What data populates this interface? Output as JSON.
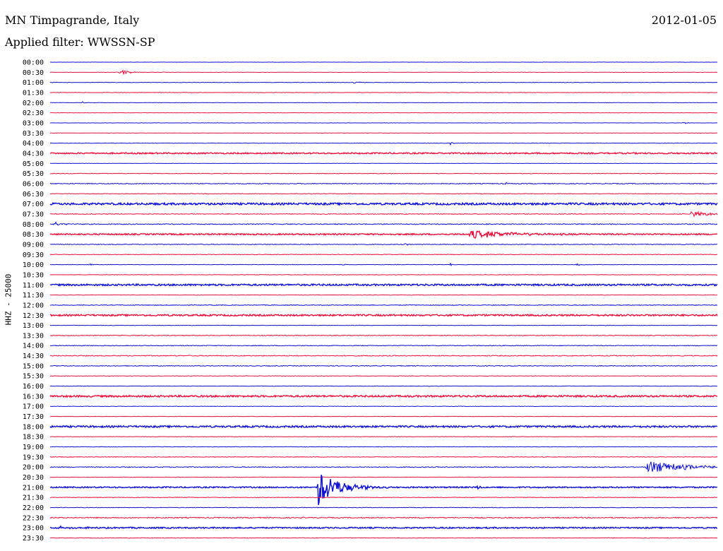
{
  "header": {
    "station": "MN Timpagrande, Italy",
    "filter_label": "Applied filter: WWSSN-SP",
    "date": "2012-01-05"
  },
  "chart_data": {
    "type": "line",
    "title": "MN Timpagrande, Italy",
    "subtitle": "Applied filter: WWSSN-SP",
    "date": "2012-01-05",
    "ylabel": "HHZ - 25000",
    "xlabel": "",
    "grid": false,
    "row_minutes": 30,
    "colors": {
      "even_row": "#1010d0",
      "odd_row": "#e8103c"
    },
    "rows": [
      {
        "label": "00:00",
        "noise": 0.2,
        "events": []
      },
      {
        "label": "00:30",
        "noise": 0.2,
        "events": [
          {
            "t": 0.105,
            "amp": 5,
            "dur": 0.015
          }
        ]
      },
      {
        "label": "01:00",
        "noise": 0.3,
        "events": [
          {
            "t": 0.455,
            "amp": 2,
            "dur": 0.012
          }
        ]
      },
      {
        "label": "01:30",
        "noise": 0.3,
        "events": []
      },
      {
        "label": "02:00",
        "noise": 0.2,
        "events": [
          {
            "t": 0.048,
            "amp": 2,
            "dur": 0.004
          }
        ]
      },
      {
        "label": "02:30",
        "noise": 0.2,
        "events": []
      },
      {
        "label": "03:00",
        "noise": 0.2,
        "events": [
          {
            "t": 0.95,
            "amp": 2,
            "dur": 0.006
          }
        ]
      },
      {
        "label": "03:30",
        "noise": 0.2,
        "events": []
      },
      {
        "label": "04:00",
        "noise": 0.3,
        "events": [
          {
            "t": 0.6,
            "amp": 2,
            "dur": 0.005
          }
        ]
      },
      {
        "label": "04:30",
        "noise": 0.9,
        "events": []
      },
      {
        "label": "05:00",
        "noise": 0.2,
        "events": []
      },
      {
        "label": "05:30",
        "noise": 0.4,
        "events": []
      },
      {
        "label": "06:00",
        "noise": 0.6,
        "events": [
          {
            "t": 0.683,
            "amp": 2,
            "dur": 0.004
          }
        ]
      },
      {
        "label": "06:30",
        "noise": 0.4,
        "events": []
      },
      {
        "label": "07:00",
        "noise": 1.4,
        "events": []
      },
      {
        "label": "07:30",
        "noise": 0.5,
        "events": [
          {
            "t": 0.96,
            "amp": 4,
            "dur": 0.04
          }
        ]
      },
      {
        "label": "08:00",
        "noise": 0.6,
        "events": [
          {
            "t": 0.006,
            "amp": 3,
            "dur": 0.015
          }
        ]
      },
      {
        "label": "08:30",
        "noise": 0.9,
        "events": [
          {
            "t": 0.63,
            "amp": 6,
            "dur": 0.07
          }
        ]
      },
      {
        "label": "09:00",
        "noise": 0.5,
        "events": [
          {
            "t": 0.533,
            "amp": 2,
            "dur": 0.004
          }
        ]
      },
      {
        "label": "09:30",
        "noise": 0.4,
        "events": []
      },
      {
        "label": "10:00",
        "noise": 0.3,
        "events": [
          {
            "t": 0.06,
            "amp": 2,
            "dur": 0.003
          },
          {
            "t": 0.44,
            "amp": 2,
            "dur": 0.003
          },
          {
            "t": 0.6,
            "amp": 2,
            "dur": 0.003
          },
          {
            "t": 0.79,
            "amp": 3,
            "dur": 0.01
          }
        ]
      },
      {
        "label": "10:30",
        "noise": 0.3,
        "events": []
      },
      {
        "label": "11:00",
        "noise": 1.2,
        "events": []
      },
      {
        "label": "11:30",
        "noise": 0.3,
        "events": []
      },
      {
        "label": "12:00",
        "noise": 0.5,
        "events": []
      },
      {
        "label": "12:30",
        "noise": 1.1,
        "events": []
      },
      {
        "label": "13:00",
        "noise": 0.3,
        "events": []
      },
      {
        "label": "13:30",
        "noise": 0.5,
        "events": []
      },
      {
        "label": "14:00",
        "noise": 0.5,
        "events": []
      },
      {
        "label": "14:30",
        "noise": 0.6,
        "events": []
      },
      {
        "label": "15:00",
        "noise": 0.5,
        "events": []
      },
      {
        "label": "15:30",
        "noise": 0.3,
        "events": []
      },
      {
        "label": "16:00",
        "noise": 0.3,
        "events": []
      },
      {
        "label": "16:30",
        "noise": 1.2,
        "events": []
      },
      {
        "label": "17:00",
        "noise": 0.3,
        "events": []
      },
      {
        "label": "17:30",
        "noise": 0.3,
        "events": []
      },
      {
        "label": "18:00",
        "noise": 1.2,
        "events": []
      },
      {
        "label": "18:30",
        "noise": 0.3,
        "events": []
      },
      {
        "label": "19:00",
        "noise": 0.3,
        "events": []
      },
      {
        "label": "19:30",
        "noise": 0.4,
        "events": []
      },
      {
        "label": "20:00",
        "noise": 0.6,
        "events": [
          {
            "t": 0.895,
            "amp": 9,
            "dur": 0.07
          }
        ]
      },
      {
        "label": "20:30",
        "noise": 0.3,
        "events": []
      },
      {
        "label": "21:00",
        "noise": 0.9,
        "events": [
          {
            "t": 0.402,
            "amp": 26,
            "dur": 0.035
          },
          {
            "t": 0.64,
            "amp": 3,
            "dur": 0.006
          }
        ]
      },
      {
        "label": "21:30",
        "noise": 0.4,
        "events": []
      },
      {
        "label": "22:00",
        "noise": 0.4,
        "events": []
      },
      {
        "label": "22:30",
        "noise": 0.7,
        "events": []
      },
      {
        "label": "23:00",
        "noise": 0.9,
        "events": [
          {
            "t": 0.01,
            "amp": 2,
            "dur": 0.03
          }
        ]
      },
      {
        "label": "23:30",
        "noise": 0.4,
        "events": []
      }
    ]
  }
}
